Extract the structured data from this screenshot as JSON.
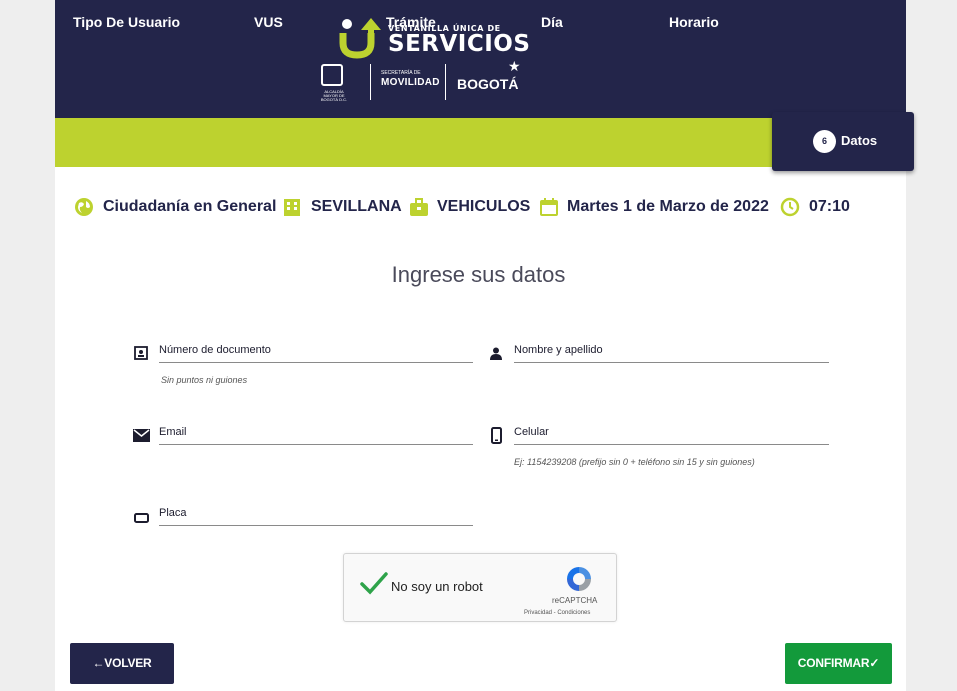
{
  "header": {
    "logo_small": "VENTANILLA ÚNICA DE",
    "logo_big": "SERVICIOS",
    "crest_text": "ALCALDÍA MAYOR DE BOGOTÁ D.C.",
    "secretaria_small": "SECRETARÍA DE",
    "secretaria_big": "MOVILIDAD",
    "bogota": "BOGOTÁ"
  },
  "steps": [
    {
      "label": "Tipo De Usuario"
    },
    {
      "label": "VUS"
    },
    {
      "label": "Trámite"
    },
    {
      "label": "Día"
    },
    {
      "label": "Horario"
    }
  ],
  "active_step": {
    "number": "6",
    "label": "Datos"
  },
  "summary": {
    "user_type": "Ciudadanía en General",
    "office": "SEVILLANA",
    "procedure": "VEHICULOS",
    "date": "Martes 1 de Marzo de 2022",
    "time": "07:10"
  },
  "form": {
    "title": "Ingrese sus datos",
    "documento_label": "Número de documento",
    "documento_hint": "Sin puntos ni guiones",
    "nombre_label": "Nombre y apellido",
    "email_label": "Email",
    "celular_label": "Celular",
    "celular_hint": "Ej: 1154239208 (prefijo sin 0 + teléfono sin 15 y sin guiones)",
    "placa_label": "Placa"
  },
  "captcha": {
    "label": "No soy un robot",
    "brand": "reCAPTCHA",
    "links": "Privacidad - Condiciones"
  },
  "buttons": {
    "back": "←VOLVER",
    "confirm": "CONFIRMAR✓"
  },
  "colors": {
    "navy": "#23254a",
    "lime": "#bdd22f",
    "green": "#139a3b"
  }
}
